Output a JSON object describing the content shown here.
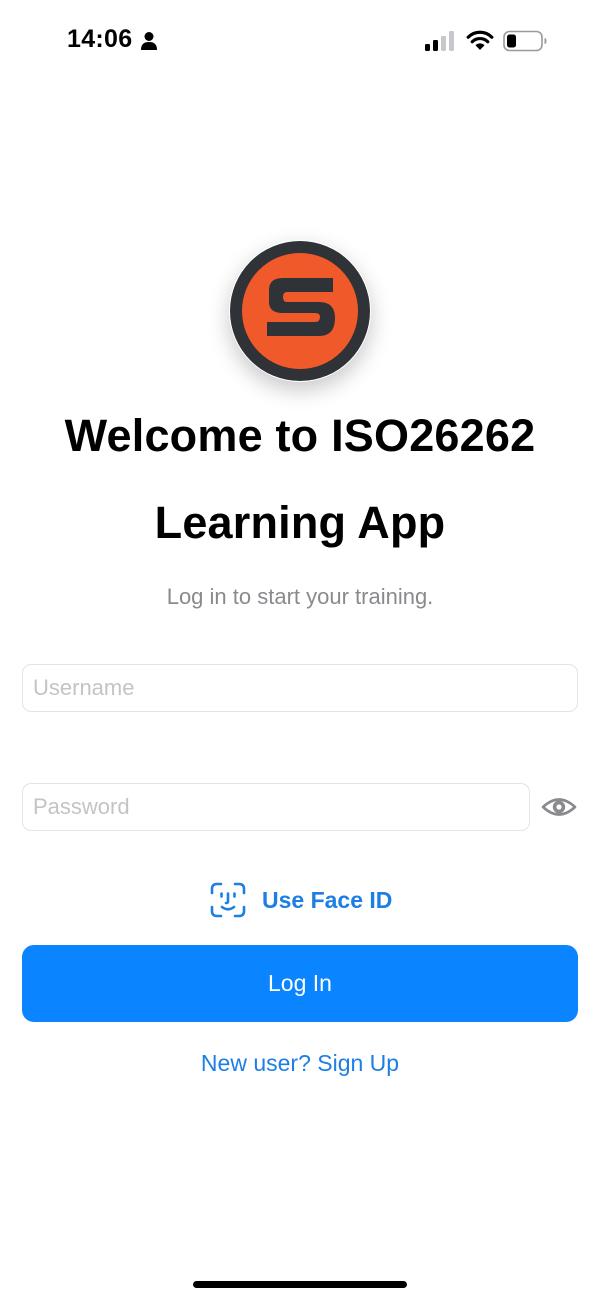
{
  "status_bar": {
    "time": "14:06",
    "icons": [
      "person-icon",
      "cellular-signal-icon",
      "wifi-icon",
      "battery-icon"
    ]
  },
  "logo": {
    "letter": "S",
    "colors": {
      "ring": "#2f3237",
      "fill": "#f0592a",
      "letter": "#2f3237"
    }
  },
  "welcome": {
    "title_line1": "Welcome to ISO26262",
    "title_line2": "Learning App",
    "subtitle": "Log in to start your training."
  },
  "form": {
    "username": {
      "value": "",
      "placeholder": "Username"
    },
    "password": {
      "value": "",
      "placeholder": "Password"
    },
    "toggle_visibility_icon": "eye-icon"
  },
  "face_id": {
    "label": "Use Face ID",
    "icon": "face-id-icon"
  },
  "actions": {
    "login_label": "Log In",
    "signup_label": "New user? Sign Up"
  },
  "colors": {
    "accent": "#0a84ff",
    "link": "#1d7fe3",
    "subtitle": "#8a8a8e",
    "placeholder": "#c4c4c7",
    "field_border": "#e4e4e6"
  }
}
